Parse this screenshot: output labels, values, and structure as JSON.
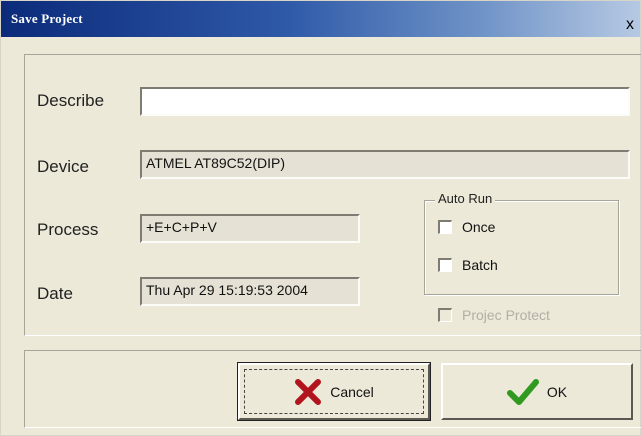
{
  "window": {
    "title": "Save Project",
    "close_glyph": "x"
  },
  "form": {
    "describe": {
      "label": "Describe",
      "value": ""
    },
    "device": {
      "label": "Device",
      "value": "ATMEL  AT89C52(DIP)"
    },
    "process": {
      "label": "Process",
      "value": "+E+C+P+V"
    },
    "date": {
      "label": "Date",
      "value": "Thu Apr 29 15:19:53 2004"
    }
  },
  "auto_run": {
    "title": "Auto Run",
    "once": {
      "label": "Once",
      "checked": false
    },
    "batch": {
      "label": "Batch",
      "checked": false
    }
  },
  "project_protect": {
    "label": "Projec Protect",
    "checked": false,
    "enabled": false
  },
  "buttons": {
    "cancel": {
      "label": "Cancel",
      "icon": "red-x-icon"
    },
    "ok": {
      "label": "OK",
      "icon": "green-check-icon"
    }
  },
  "colors": {
    "cancel_icon": "#b2141e",
    "ok_icon": "#2f9a1f",
    "title_bar": "#0b2a7a"
  }
}
